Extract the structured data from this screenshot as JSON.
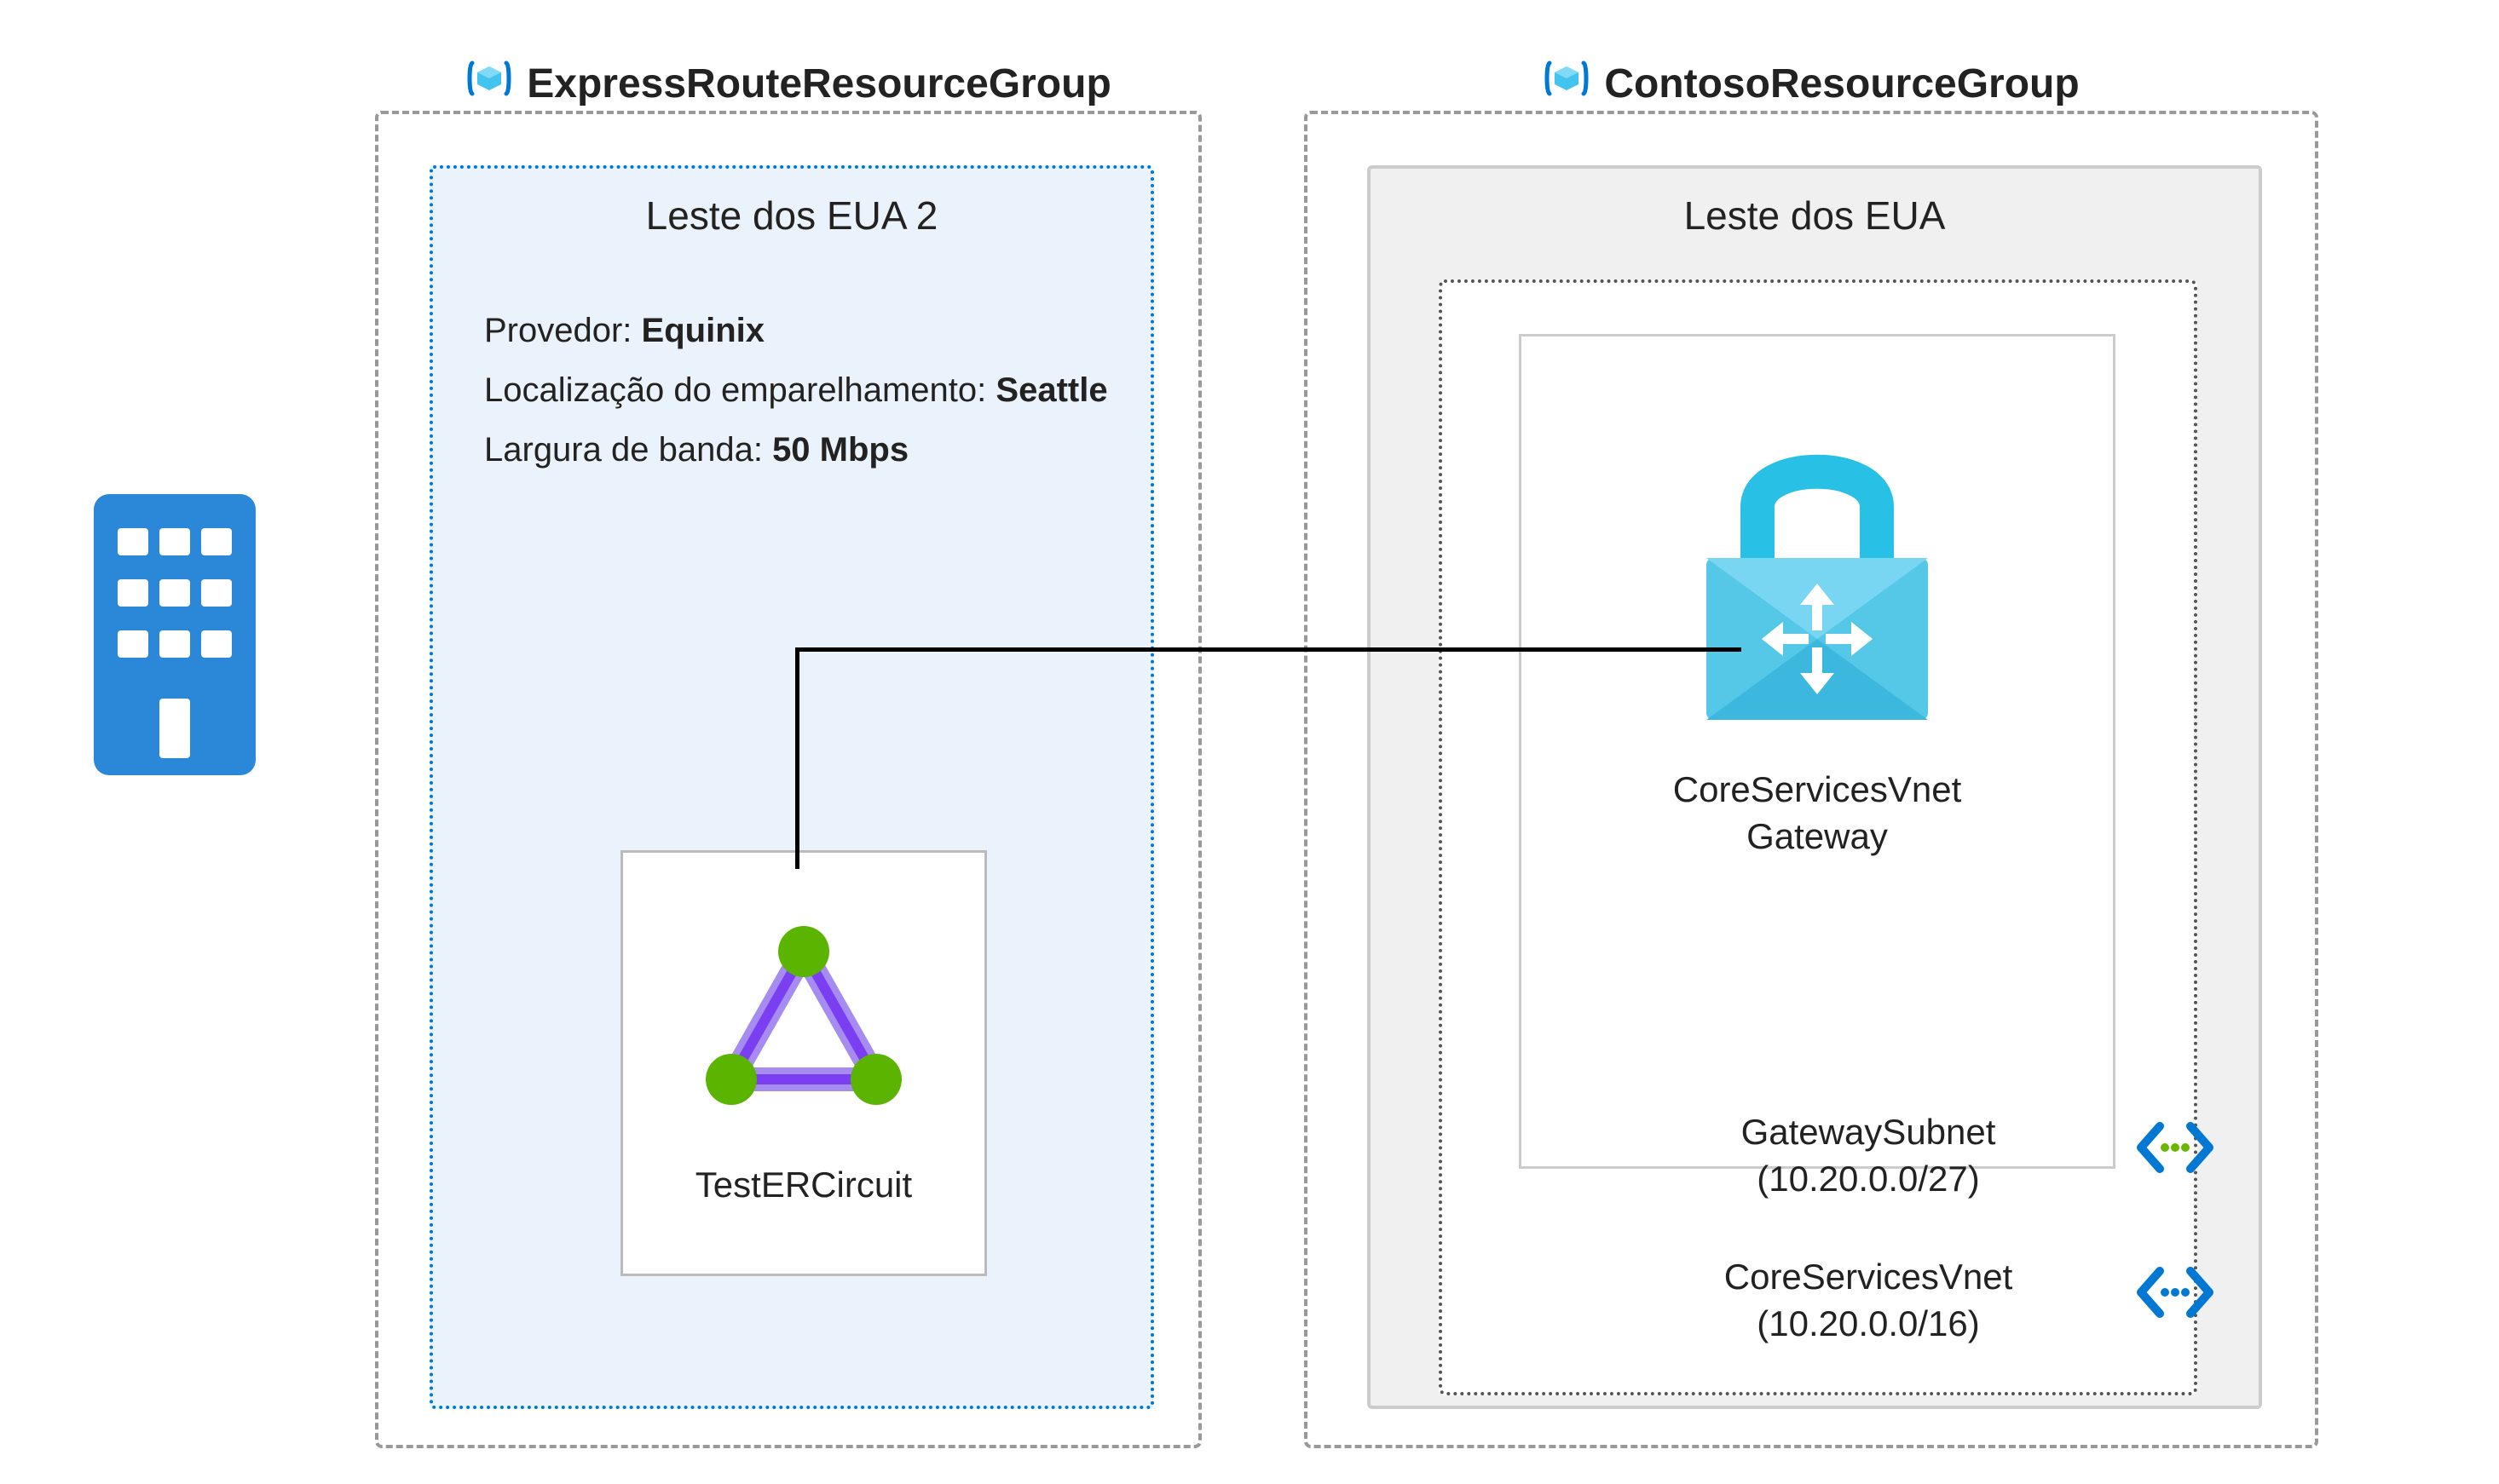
{
  "left_rg": {
    "title": "ExpressRouteResourceGroup",
    "region_title": "Leste dos EUA 2",
    "info": {
      "provider_label": "Provedor:",
      "provider_value": "Equinix",
      "peering_label": "Localização do emparelhamento:",
      "peering_value": "Seattle",
      "bandwidth_label": "Largura de banda:",
      "bandwidth_value": "50 Mbps"
    },
    "circuit_label": "TestERCircuit"
  },
  "right_rg": {
    "title": "ContosoResourceGroup",
    "region_title": "Leste dos EUA",
    "gateway_label_line1": "CoreServicesVnet",
    "gateway_label_line2": "Gateway",
    "subnet1_name": "GatewaySubnet",
    "subnet1_cidr": "(10.20.0.0/27)",
    "subnet2_name": "CoreServicesVnet",
    "subnet2_cidr": "(10.20.0.0/16)"
  }
}
